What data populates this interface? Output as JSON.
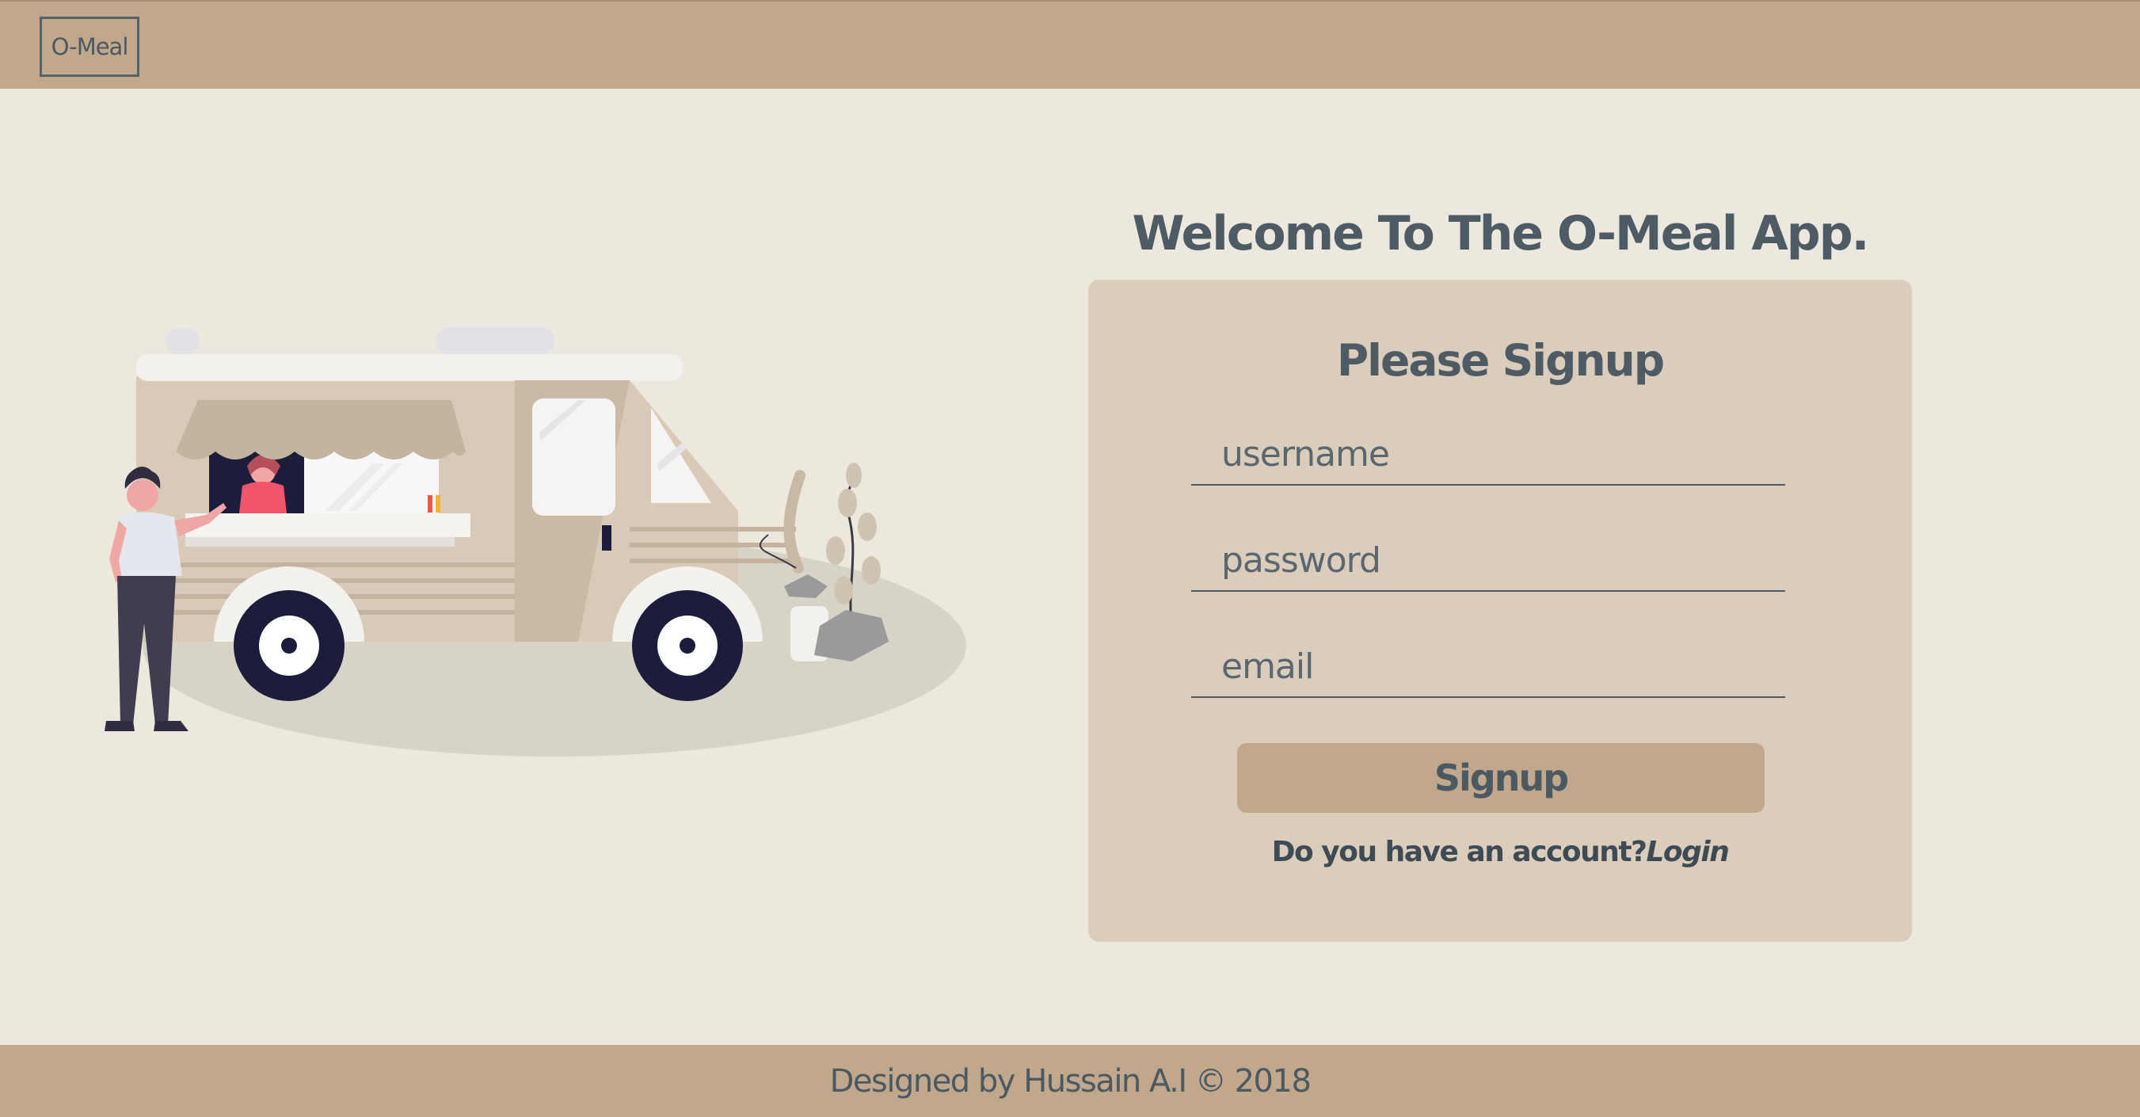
{
  "navbar": {
    "brand": "O-Meal"
  },
  "main": {
    "welcome": "Welcome To The O-Meal App.",
    "signup_card": {
      "title": "Please Signup",
      "username_placeholder": "username",
      "password_placeholder": "password",
      "email_placeholder": "email",
      "submit_label": "Signup",
      "account_question": "Do you have an account?",
      "login_link": "Login"
    }
  },
  "footer": {
    "text": "Designed by Hussain A.I © 2018"
  },
  "colors": {
    "navbar": "#c1a78b",
    "page_background": "#ede8de",
    "card": "#dbcdbb",
    "text": "#4e5b64",
    "button": "#c1a78b"
  },
  "illustration": {
    "subject": "food-truck-illustration"
  }
}
